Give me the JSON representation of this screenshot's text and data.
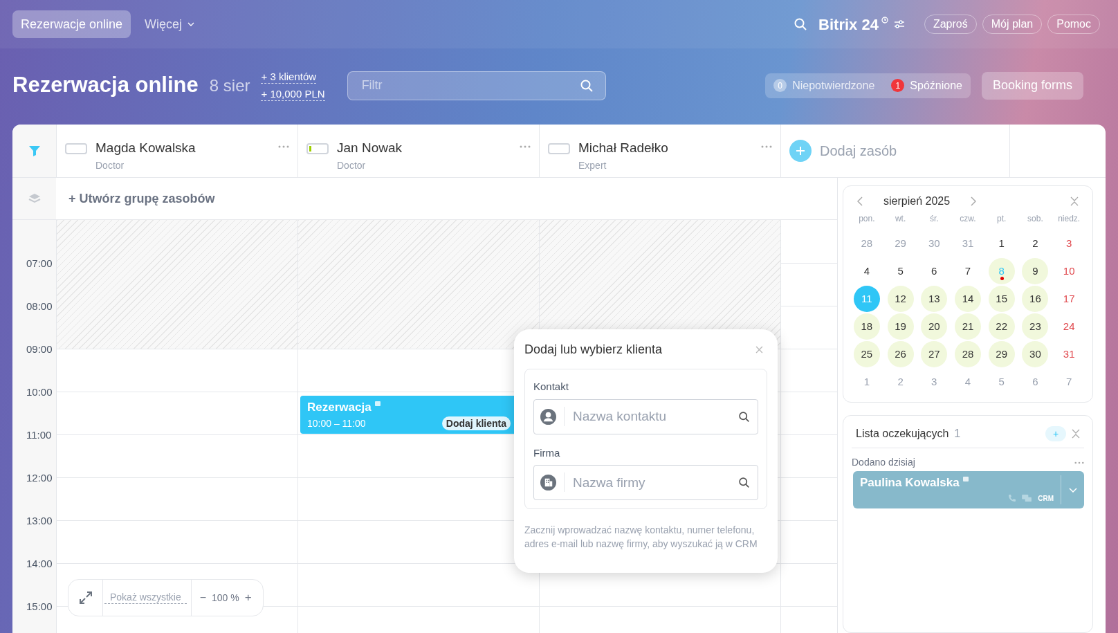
{
  "topbar": {
    "tabs": [
      {
        "label": "Rezerwacje online",
        "selected": true
      },
      {
        "label": "Więcej",
        "selected": false,
        "dropdown": true
      }
    ],
    "logo": "Bitrix",
    "logo_number": "24",
    "buttons": [
      "Zaproś",
      "Mój plan",
      "Pomoc"
    ]
  },
  "header": {
    "title": "Rezerwacja online",
    "date": "8 sier",
    "stats": [
      "+ 3 klientów",
      "+ 10,000 PLN"
    ],
    "filter": {
      "placeholder": "Filtr"
    },
    "counters": [
      {
        "count": "0",
        "label": "Niepotwierdzone",
        "kind": "neutral"
      },
      {
        "count": "1",
        "label": "Spóźnione",
        "kind": "alert"
      }
    ],
    "booking_forms": "Booking forms"
  },
  "resources": [
    {
      "name": "Magda Kowalska",
      "role": "Doctor",
      "busy": false
    },
    {
      "name": "Jan Nowak",
      "role": "Doctor",
      "busy": true
    },
    {
      "name": "Michał Radełko",
      "role": "Expert",
      "busy": false
    }
  ],
  "add_resource": "Dodaj zasób",
  "create_group": "+ Utwórz grupę zasobów",
  "hours": [
    "07:00",
    "08:00",
    "09:00",
    "10:00",
    "11:00",
    "12:00",
    "13:00",
    "14:00",
    "15:00"
  ],
  "booking": {
    "title": "Rezerwacja",
    "time": "10:00 – 11:00",
    "action": "Dodaj klienta"
  },
  "zoom_bar": {
    "show_all": "Pokaż wszystkie",
    "minus": "−",
    "zoom": "100 %",
    "plus": "+"
  },
  "popup": {
    "title": "Dodaj lub wybierz klienta",
    "sections": [
      {
        "label": "Kontakt",
        "placeholder": "Nazwa kontaktu",
        "kind": "contact"
      },
      {
        "label": "Firma",
        "placeholder": "Nazwa firmy",
        "kind": "company"
      }
    ],
    "hint": "Zacznij wprowadzać nazwę kontaktu, numer telefonu, adres e-mail lub nazwę firmy, aby wyszukać ją w CRM"
  },
  "calendar": {
    "month": "sierpień 2025",
    "weekdays": [
      "pon.",
      "wt.",
      "śr.",
      "czw.",
      "pt.",
      "sob.",
      "niedz."
    ],
    "days": [
      {
        "label": "28",
        "kind": "outside",
        "available": false,
        "selected": false,
        "today": false
      },
      {
        "label": "29",
        "kind": "outside",
        "available": false,
        "selected": false,
        "today": false
      },
      {
        "label": "30",
        "kind": "outside",
        "available": false,
        "selected": false,
        "today": false
      },
      {
        "label": "31",
        "kind": "outside",
        "available": false,
        "selected": false,
        "today": false
      },
      {
        "label": "1",
        "kind": "workday",
        "available": false,
        "selected": false,
        "today": false
      },
      {
        "label": "2",
        "kind": "workday",
        "available": false,
        "selected": false,
        "today": false
      },
      {
        "label": "3",
        "kind": "sunday",
        "available": false,
        "selected": false,
        "today": false
      },
      {
        "label": "4",
        "kind": "workday",
        "available": false,
        "selected": false,
        "today": false
      },
      {
        "label": "5",
        "kind": "workday",
        "available": false,
        "selected": false,
        "today": false
      },
      {
        "label": "6",
        "kind": "workday",
        "available": false,
        "selected": false,
        "today": false
      },
      {
        "label": "7",
        "kind": "workday",
        "available": false,
        "selected": false,
        "today": false
      },
      {
        "label": "8",
        "kind": "workday",
        "available": true,
        "selected": false,
        "today": true
      },
      {
        "label": "9",
        "kind": "workday",
        "available": true,
        "selected": false,
        "today": false
      },
      {
        "label": "10",
        "kind": "sunday",
        "available": false,
        "selected": false,
        "today": false
      },
      {
        "label": "11",
        "kind": "workday",
        "available": true,
        "selected": true,
        "today": false
      },
      {
        "label": "12",
        "kind": "workday",
        "available": true,
        "selected": false,
        "today": false
      },
      {
        "label": "13",
        "kind": "workday",
        "available": true,
        "selected": false,
        "today": false
      },
      {
        "label": "14",
        "kind": "workday",
        "available": true,
        "selected": false,
        "today": false
      },
      {
        "label": "15",
        "kind": "workday",
        "available": true,
        "selected": false,
        "today": false
      },
      {
        "label": "16",
        "kind": "workday",
        "available": true,
        "selected": false,
        "today": false
      },
      {
        "label": "17",
        "kind": "sunday",
        "available": false,
        "selected": false,
        "today": false
      },
      {
        "label": "18",
        "kind": "workday",
        "available": true,
        "selected": false,
        "today": false
      },
      {
        "label": "19",
        "kind": "workday",
        "available": true,
        "selected": false,
        "today": false
      },
      {
        "label": "20",
        "kind": "workday",
        "available": true,
        "selected": false,
        "today": false
      },
      {
        "label": "21",
        "kind": "workday",
        "available": true,
        "selected": false,
        "today": false
      },
      {
        "label": "22",
        "kind": "workday",
        "available": true,
        "selected": false,
        "today": false
      },
      {
        "label": "23",
        "kind": "workday",
        "available": true,
        "selected": false,
        "today": false
      },
      {
        "label": "24",
        "kind": "sunday",
        "available": false,
        "selected": false,
        "today": false
      },
      {
        "label": "25",
        "kind": "workday",
        "available": true,
        "selected": false,
        "today": false
      },
      {
        "label": "26",
        "kind": "workday",
        "available": true,
        "selected": false,
        "today": false
      },
      {
        "label": "27",
        "kind": "workday",
        "available": true,
        "selected": false,
        "today": false
      },
      {
        "label": "28",
        "kind": "workday",
        "available": true,
        "selected": false,
        "today": false
      },
      {
        "label": "29",
        "kind": "workday",
        "available": true,
        "selected": false,
        "today": false
      },
      {
        "label": "30",
        "kind": "workday",
        "available": true,
        "selected": false,
        "today": false
      },
      {
        "label": "31",
        "kind": "sunday",
        "available": false,
        "selected": false,
        "today": false
      },
      {
        "label": "1",
        "kind": "outside",
        "available": false,
        "selected": false,
        "today": false
      },
      {
        "label": "2",
        "kind": "outside",
        "available": false,
        "selected": false,
        "today": false
      },
      {
        "label": "3",
        "kind": "outside",
        "available": false,
        "selected": false,
        "today": false
      },
      {
        "label": "4",
        "kind": "outside",
        "available": false,
        "selected": false,
        "today": false
      },
      {
        "label": "5",
        "kind": "outside",
        "available": false,
        "selected": false,
        "today": false
      },
      {
        "label": "6",
        "kind": "outside",
        "available": false,
        "selected": false,
        "today": false
      },
      {
        "label": "7",
        "kind": "outside",
        "available": false,
        "selected": false,
        "today": false
      }
    ]
  },
  "waiting_list": {
    "title": "Lista oczekujących",
    "count": "1",
    "group": "Dodano dzisiaj",
    "add": "+",
    "items": [
      {
        "name": "Paulina Kowalska",
        "badge": "CRM"
      }
    ]
  }
}
